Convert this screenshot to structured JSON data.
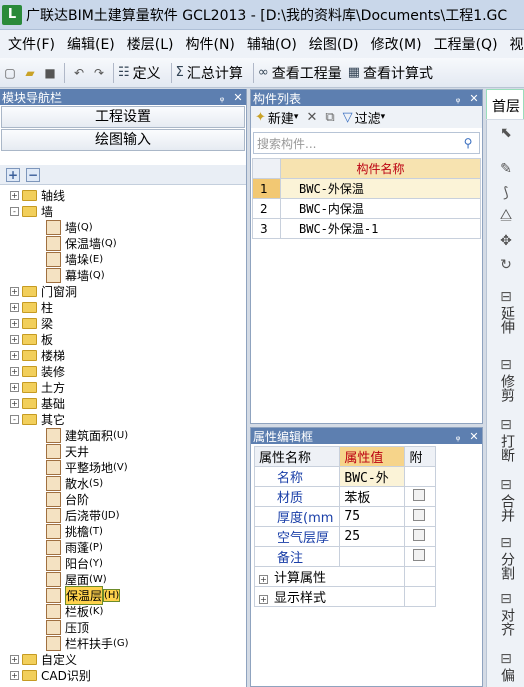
{
  "app": {
    "logo": "L",
    "title": "广联达BIM土建算量软件 GCL2013 - [D:\\我的资料库\\Documents\\工程1.GC"
  },
  "menu": [
    "文件(F)",
    "编辑(E)",
    "楼层(L)",
    "构件(N)",
    "辅轴(O)",
    "绘图(D)",
    "修改(M)",
    "工程量(Q)",
    "视"
  ],
  "toolbar": {
    "define": "定义",
    "summary": "汇总计算",
    "view_qty": "查看工程量",
    "view_calc": "查看计算式"
  },
  "nav": {
    "title": "模块导航栏",
    "project_settings": "工程设置",
    "drawing_input": "绘图输入",
    "tree": [
      {
        "label": "轴线",
        "type": "folder",
        "state": "+"
      },
      {
        "label": "墙",
        "type": "folder",
        "state": "-"
      },
      {
        "label": "墙",
        "key": "(Q)",
        "type": "leaf"
      },
      {
        "label": "保温墙",
        "key": "(Q)",
        "type": "leaf"
      },
      {
        "label": "墙垛",
        "key": "(E)",
        "type": "leaf"
      },
      {
        "label": "幕墙",
        "key": "(Q)",
        "type": "leaf"
      },
      {
        "label": "门窗洞",
        "type": "folder",
        "state": "+"
      },
      {
        "label": "柱",
        "type": "folder",
        "state": "+"
      },
      {
        "label": "梁",
        "type": "folder",
        "state": "+"
      },
      {
        "label": "板",
        "type": "folder",
        "state": "+"
      },
      {
        "label": "楼梯",
        "type": "folder",
        "state": "+"
      },
      {
        "label": "装修",
        "type": "folder",
        "state": "+"
      },
      {
        "label": "土方",
        "type": "folder",
        "state": "+"
      },
      {
        "label": "基础",
        "type": "folder",
        "state": "+"
      },
      {
        "label": "其它",
        "type": "folder",
        "state": "-"
      },
      {
        "label": "建筑面积",
        "key": "(U)",
        "type": "leaf"
      },
      {
        "label": "天井",
        "key": "",
        "type": "leaf"
      },
      {
        "label": "平整场地",
        "key": "(V)",
        "type": "leaf"
      },
      {
        "label": "散水",
        "key": "(S)",
        "type": "leaf"
      },
      {
        "label": "台阶",
        "key": "",
        "type": "leaf"
      },
      {
        "label": "后浇带",
        "key": "(JD)",
        "type": "leaf"
      },
      {
        "label": "挑檐",
        "key": "(T)",
        "type": "leaf"
      },
      {
        "label": "雨蓬",
        "key": "(P)",
        "type": "leaf"
      },
      {
        "label": "阳台",
        "key": "(Y)",
        "type": "leaf"
      },
      {
        "label": "屋面",
        "key": "(W)",
        "type": "leaf"
      },
      {
        "label": "保温层",
        "key": "(H)",
        "type": "leaf",
        "selected": true
      },
      {
        "label": "栏板",
        "key": "(K)",
        "type": "leaf"
      },
      {
        "label": "压顶",
        "key": "",
        "type": "leaf"
      },
      {
        "label": "栏杆扶手",
        "key": "(G)",
        "type": "leaf"
      },
      {
        "label": "自定义",
        "type": "folder",
        "state": "+"
      },
      {
        "label": "CAD识别",
        "type": "folder",
        "state": "+"
      }
    ]
  },
  "complist": {
    "title": "构件列表",
    "new": "新建",
    "filter": "过滤",
    "search_placeholder": "搜索构件...",
    "column": "构件名称",
    "rows": [
      {
        "num": "1",
        "name": "BWC-外保温",
        "selected": true
      },
      {
        "num": "2",
        "name": "BWC-内保温"
      },
      {
        "num": "3",
        "name": "BWC-外保温-1"
      }
    ]
  },
  "props": {
    "title": "属性编辑框",
    "col_name": "属性名称",
    "col_value": "属性值",
    "col_attach": "附",
    "rows": [
      {
        "name": "名称",
        "value": "BWC-外"
      },
      {
        "name": "材质",
        "value": "苯板"
      },
      {
        "name": "厚度(mm",
        "value": "75"
      },
      {
        "name": "空气层厚",
        "value": "25"
      },
      {
        "name": "备注",
        "value": ""
      }
    ],
    "groups": [
      "计算属性",
      "显示样式"
    ]
  },
  "right": {
    "tab": "首层",
    "tools": [
      "延伸",
      "修剪",
      "打断",
      "合并",
      "分割",
      "对齐",
      "偏"
    ]
  }
}
